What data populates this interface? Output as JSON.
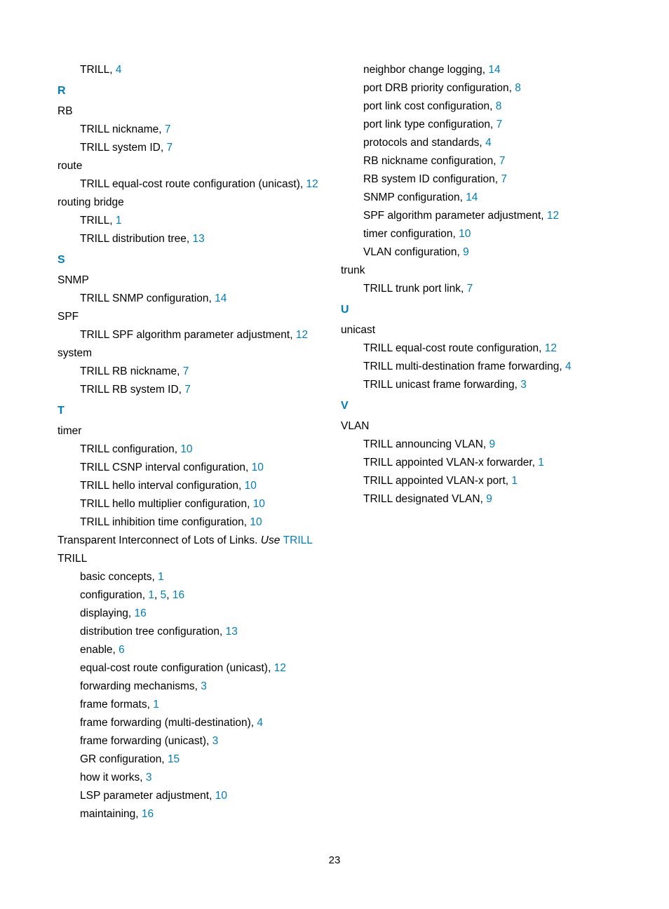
{
  "page_number": "23",
  "col1": {
    "top_entry": {
      "text": "TRILL, ",
      "page": "4"
    },
    "sections": [
      {
        "letter": "R",
        "groups": [
          {
            "term": "RB",
            "subs": [
              {
                "text": "TRILL nickname, ",
                "page": "7"
              },
              {
                "text": "TRILL system ID, ",
                "page": "7"
              }
            ]
          },
          {
            "term": "route",
            "subs": [
              {
                "text": "TRILL equal-cost route configuration (unicast), ",
                "page": "12"
              }
            ]
          },
          {
            "term": "routing bridge",
            "subs": [
              {
                "text": "TRILL, ",
                "page": "1"
              },
              {
                "text": "TRILL distribution tree, ",
                "page": "13"
              }
            ]
          }
        ]
      },
      {
        "letter": "S",
        "groups": [
          {
            "term": "SNMP",
            "subs": [
              {
                "text": "TRILL SNMP configuration, ",
                "page": "14"
              }
            ]
          },
          {
            "term": "SPF",
            "subs": [
              {
                "text": "TRILL SPF algorithm parameter adjustment, ",
                "page": "12"
              }
            ]
          },
          {
            "term": "system",
            "subs": [
              {
                "text": "TRILL RB nickname, ",
                "page": "7"
              },
              {
                "text": "TRILL RB system ID, ",
                "page": "7"
              }
            ]
          }
        ]
      },
      {
        "letter": "T",
        "groups": [
          {
            "term": "timer",
            "subs": [
              {
                "text": "TRILL configuration, ",
                "page": "10"
              },
              {
                "text": "TRILL CSNP interval configuration, ",
                "page": "10"
              },
              {
                "text": "TRILL hello interval configuration, ",
                "page": "10"
              },
              {
                "text": "TRILL hello multiplier configuration, ",
                "page": "10"
              },
              {
                "text": "TRILL inhibition time configuration, ",
                "page": "10"
              }
            ]
          },
          {
            "special": {
              "pre": "Transparent Interconnect of Lots of Links. ",
              "use": "Use ",
              "link": "TRILL"
            }
          },
          {
            "term": "TRILL",
            "subs": [
              {
                "text": "basic concepts, ",
                "page": "1"
              },
              {
                "multi": {
                  "text": "configuration, ",
                  "pages": [
                    "1",
                    "5",
                    "16"
                  ]
                }
              },
              {
                "text": "displaying, ",
                "page": "16"
              },
              {
                "text": "distribution tree configuration, ",
                "page": "13"
              },
              {
                "text": "enable, ",
                "page": "6"
              },
              {
                "text": "equal-cost route configuration (unicast), ",
                "page": "12"
              },
              {
                "text": "forwarding mechanisms, ",
                "page": "3"
              },
              {
                "text": "frame formats, ",
                "page": "1"
              },
              {
                "text": "frame forwarding (multi-destination), ",
                "page": "4"
              },
              {
                "text": "frame forwarding (unicast), ",
                "page": "3"
              },
              {
                "text": "GR configuration, ",
                "page": "15"
              },
              {
                "text": "how it works, ",
                "page": "3"
              },
              {
                "text": "LSP parameter adjustment, ",
                "page": "10"
              },
              {
                "text": "maintaining, ",
                "page": "16"
              },
              {
                "text": "neighbor change logging, ",
                "page": "14"
              },
              {
                "text": "port DRB priority configuration, ",
                "page": "8"
              }
            ]
          }
        ]
      }
    ]
  },
  "col2": {
    "trill_cont": [
      {
        "text": "port link cost configuration, ",
        "page": "8"
      },
      {
        "text": "port link type configuration, ",
        "page": "7"
      },
      {
        "text": "protocols and standards, ",
        "page": "4"
      },
      {
        "text": "RB nickname configuration, ",
        "page": "7"
      },
      {
        "text": "RB system ID configuration, ",
        "page": "7"
      },
      {
        "text": "SNMP configuration, ",
        "page": "14"
      },
      {
        "text": "SPF algorithm parameter adjustment, ",
        "page": "12"
      },
      {
        "text": "timer configuration, ",
        "page": "10"
      },
      {
        "text": "VLAN configuration, ",
        "page": "9"
      }
    ],
    "groups": [
      {
        "term": "trunk",
        "subs": [
          {
            "text": "TRILL trunk port link, ",
            "page": "7"
          }
        ]
      }
    ],
    "sections": [
      {
        "letter": "U",
        "groups": [
          {
            "term": "unicast",
            "subs": [
              {
                "text": "TRILL equal-cost route configuration, ",
                "page": "12"
              },
              {
                "text": "TRILL multi-destination frame forwarding, ",
                "page": "4"
              },
              {
                "text": "TRILL unicast frame forwarding, ",
                "page": "3"
              }
            ]
          }
        ]
      },
      {
        "letter": "V",
        "groups": [
          {
            "term": "VLAN",
            "subs": [
              {
                "text": "TRILL announcing VLAN, ",
                "page": "9"
              },
              {
                "text": "TRILL appointed VLAN-x forwarder, ",
                "page": "1"
              },
              {
                "text": "TRILL appointed VLAN-x port, ",
                "page": "1"
              },
              {
                "text": "TRILL designated VLAN, ",
                "page": "9"
              }
            ]
          }
        ]
      }
    ]
  }
}
